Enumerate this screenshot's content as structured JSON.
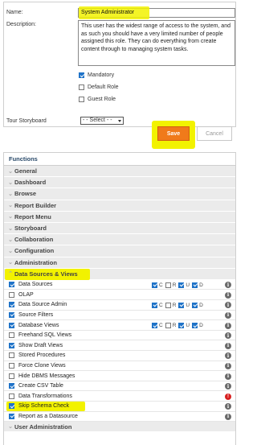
{
  "form": {
    "name_label": "Name:",
    "name_value": "System Administrator",
    "description_label": "Description:",
    "description_value": "This user has the widest range of access to the system, and as such you should have a very limited number of people assigned this role. They can do everything from create content through to managing system tasks.",
    "options": [
      {
        "label": "Mandatory",
        "checked": true
      },
      {
        "label": "Default Role",
        "checked": false
      },
      {
        "label": "Guest Role",
        "checked": false
      }
    ],
    "storyboard_label": "Tour Storyboard",
    "storyboard_select": "- - Select - -"
  },
  "buttons": {
    "save": "Save",
    "cancel": "Cancel"
  },
  "functions": {
    "title": "Functions",
    "categories": [
      "General",
      "Dashboard",
      "Browse",
      "Report Builder",
      "Report Menu",
      "Storyboard",
      "Collaboration",
      "Configuration",
      "Administration"
    ],
    "open_category": "Data Sources & Views",
    "crud_letters": [
      "C",
      "R",
      "U",
      "D"
    ],
    "items": [
      {
        "label": "Data Sources",
        "checked": true,
        "crud": [
          true,
          false,
          true,
          true
        ]
      },
      {
        "label": "OLAP",
        "checked": false
      },
      {
        "label": "Data Source Admin",
        "checked": true,
        "crud": [
          true,
          false,
          true,
          true
        ]
      },
      {
        "label": "Source Filters",
        "checked": true
      },
      {
        "label": "Database Views",
        "checked": true,
        "crud": [
          true,
          false,
          true,
          true
        ]
      },
      {
        "label": "Freehand SQL Views",
        "checked": false
      },
      {
        "label": "Show Draft Views",
        "checked": true
      },
      {
        "label": "Stored Procedures",
        "checked": false
      },
      {
        "label": "Force Clone Views",
        "checked": false
      },
      {
        "label": "Hide DBMS Messages",
        "checked": false
      },
      {
        "label": "Create CSV Table",
        "checked": true
      },
      {
        "label": "Data Transformations",
        "checked": false,
        "info": "error"
      },
      {
        "label": "Skip Schema Check",
        "checked": true
      },
      {
        "label": "Report as a Datasource",
        "checked": true
      }
    ],
    "next_category": "User Administration"
  },
  "colors": {
    "highlight": "#f2f200",
    "save": "#f07a1a",
    "checkbox": "#1f73c8",
    "error": "#d71f1f"
  }
}
